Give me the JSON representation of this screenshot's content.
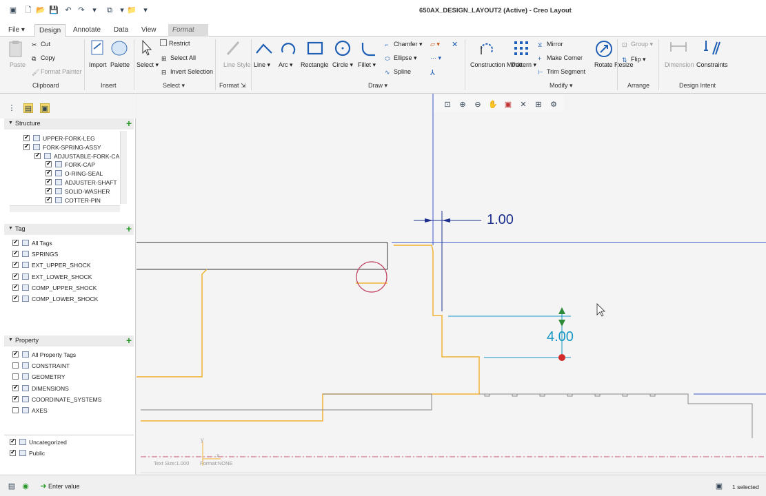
{
  "window": {
    "title": "650AX_DESIGN_LAYOUT2 (Active) - Creo Layout"
  },
  "tabs": [
    {
      "label": "File",
      "active": false
    },
    {
      "label": "Design",
      "active": true
    },
    {
      "label": "Annotate",
      "active": false
    },
    {
      "label": "Data",
      "active": false
    },
    {
      "label": "View",
      "active": false
    },
    {
      "label": "Format",
      "active": false,
      "contextual": true
    }
  ],
  "ribbon": {
    "clipboard": {
      "paste": "Paste",
      "cut": "Cut",
      "copy": "Copy",
      "format_painter": "Format Painter",
      "group": "Clipboard"
    },
    "insert": {
      "import": "Import",
      "palette": "Palette",
      "group": "Insert"
    },
    "select": {
      "select": "Select",
      "restrict": "Restrict",
      "select_all": "Select All",
      "invert_selection": "Invert Selection",
      "group": "Select"
    },
    "format": {
      "line_style": "Line Style",
      "group": "Format"
    },
    "draw": {
      "line": "Line",
      "arc": "Arc",
      "rectangle": "Rectangle",
      "circle": "Circle",
      "fillet": "Fillet",
      "chamfer": "Chamfer",
      "ellipse": "Ellipse",
      "spline": "Spline",
      "group": "Draw"
    },
    "modify": {
      "construction_mode": "Construction Mode",
      "pattern": "Pattern",
      "mirror": "Mirror",
      "make_corner": "Make Corner",
      "trim_segment": "Trim Segment",
      "rotate_resize": "Rotate Resize",
      "group": "Modify"
    },
    "arrange": {
      "group_btn": "Group",
      "flip": "Flip",
      "group": "Arrange"
    },
    "design_intent": {
      "dimension": "Dimension",
      "constraints": "Constraints",
      "group": "Design Intent"
    }
  },
  "structure": {
    "title": "Structure",
    "items": [
      {
        "label": "UPPER-FORK-LEG",
        "checked": true
      },
      {
        "label": "FORK-SPRING-ASSY",
        "checked": true
      },
      {
        "label": "ADJUSTABLE-FORK-CA",
        "checked": true
      },
      {
        "label": "FORK-CAP",
        "checked": true
      },
      {
        "label": "O-RING-SEAL",
        "checked": true
      },
      {
        "label": "ADJUSTER-SHAFT",
        "checked": true
      },
      {
        "label": "SOLID-WASHER",
        "checked": true
      },
      {
        "label": "COTTER-PIN",
        "checked": true
      }
    ]
  },
  "tag": {
    "title": "Tag",
    "items": [
      {
        "label": "All Tags",
        "checked": true
      },
      {
        "label": "SPRINGS",
        "checked": true
      },
      {
        "label": "EXT_UPPER_SHOCK",
        "checked": true
      },
      {
        "label": "EXT_LOWER_SHOCK",
        "checked": true
      },
      {
        "label": "COMP_UPPER_SHOCK",
        "checked": true
      },
      {
        "label": "COMP_LOWER_SHOCK",
        "checked": true
      }
    ]
  },
  "property": {
    "title": "Property",
    "items": [
      {
        "label": "All Property Tags",
        "checked": true
      },
      {
        "label": "CONSTRAINT",
        "checked": false
      },
      {
        "label": "GEOMETRY",
        "checked": false
      },
      {
        "label": "DIMENSIONS",
        "checked": true
      },
      {
        "label": "COORDINATE_SYSTEMS",
        "checked": true
      },
      {
        "label": "AXES",
        "checked": false
      }
    ]
  },
  "bottom_tags": [
    {
      "label": "Uncategorized",
      "checked": true
    },
    {
      "label": "Public",
      "checked": true
    }
  ],
  "canvas": {
    "dimension_1": "1.00",
    "dimension_2": "4.00",
    "text_size": "Text Size:1.000",
    "format": "Format:NONE",
    "axis_y": "y",
    "axis_x": "x"
  },
  "status": {
    "message": "Enter value",
    "selection": "1 selected"
  },
  "colors": {
    "geometry": "#f2b233",
    "dimension": "#1d2f8e",
    "active_dim": "#1596c4",
    "line": "#333333",
    "centerline": "#d04a6a"
  }
}
